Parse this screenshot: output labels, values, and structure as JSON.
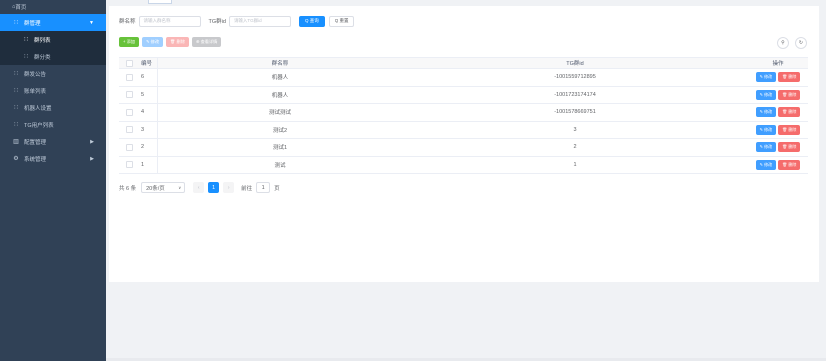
{
  "sidebar": {
    "home": "首页",
    "items": [
      {
        "label": "群管理",
        "icon": "grid-icon",
        "active": true,
        "arrow": "▼"
      },
      {
        "label": "群列表",
        "icon": "grid-icon",
        "sub": true,
        "selected": true
      },
      {
        "label": "群分类",
        "icon": "grid-icon",
        "sub": true
      },
      {
        "label": "群发公告",
        "icon": "grid-icon"
      },
      {
        "label": "账单列表",
        "icon": "grid-icon"
      },
      {
        "label": "机器人设置",
        "icon": "grid-icon"
      },
      {
        "label": "TG用户列表",
        "icon": "grid-icon"
      },
      {
        "label": "配置管理",
        "icon": "chart-icon",
        "arrow": "▶"
      },
      {
        "label": "系统管理",
        "icon": "gear-icon",
        "arrow": "▶"
      }
    ]
  },
  "search": {
    "group_name_label": "群名称",
    "group_name_placeholder": "请输入群名称",
    "tg_id_label": "TG群id",
    "tg_id_placeholder": "请输入TG群id",
    "search_btn": "Q 查询",
    "reset_btn": "Q 重置"
  },
  "toolbar": {
    "add": "+ 添加",
    "edit": "✎ 修改",
    "delete": "🗑 删除",
    "export": "⊕ 查看详情"
  },
  "table": {
    "headers": [
      "编号",
      "群名称",
      "TG群id",
      "操作"
    ],
    "rows": [
      {
        "no": "6",
        "name": "机器人",
        "tg": "-1001559712895"
      },
      {
        "no": "5",
        "name": "机器人",
        "tg": "-1001723174174"
      },
      {
        "no": "4",
        "name": "测试测试",
        "tg": "-1001578669751"
      },
      {
        "no": "3",
        "name": "测试2",
        "tg": "3"
      },
      {
        "no": "2",
        "name": "测试1",
        "tg": "2"
      },
      {
        "no": "1",
        "name": "测试",
        "tg": "1"
      }
    ],
    "edit_label": "✎ 修改",
    "delete_label": "🗑 删除"
  },
  "pager": {
    "total": "共 6 条",
    "page_size": "20条/页",
    "current": "1",
    "goto_label": "前往",
    "goto_value": "1",
    "page_suffix": "页"
  }
}
